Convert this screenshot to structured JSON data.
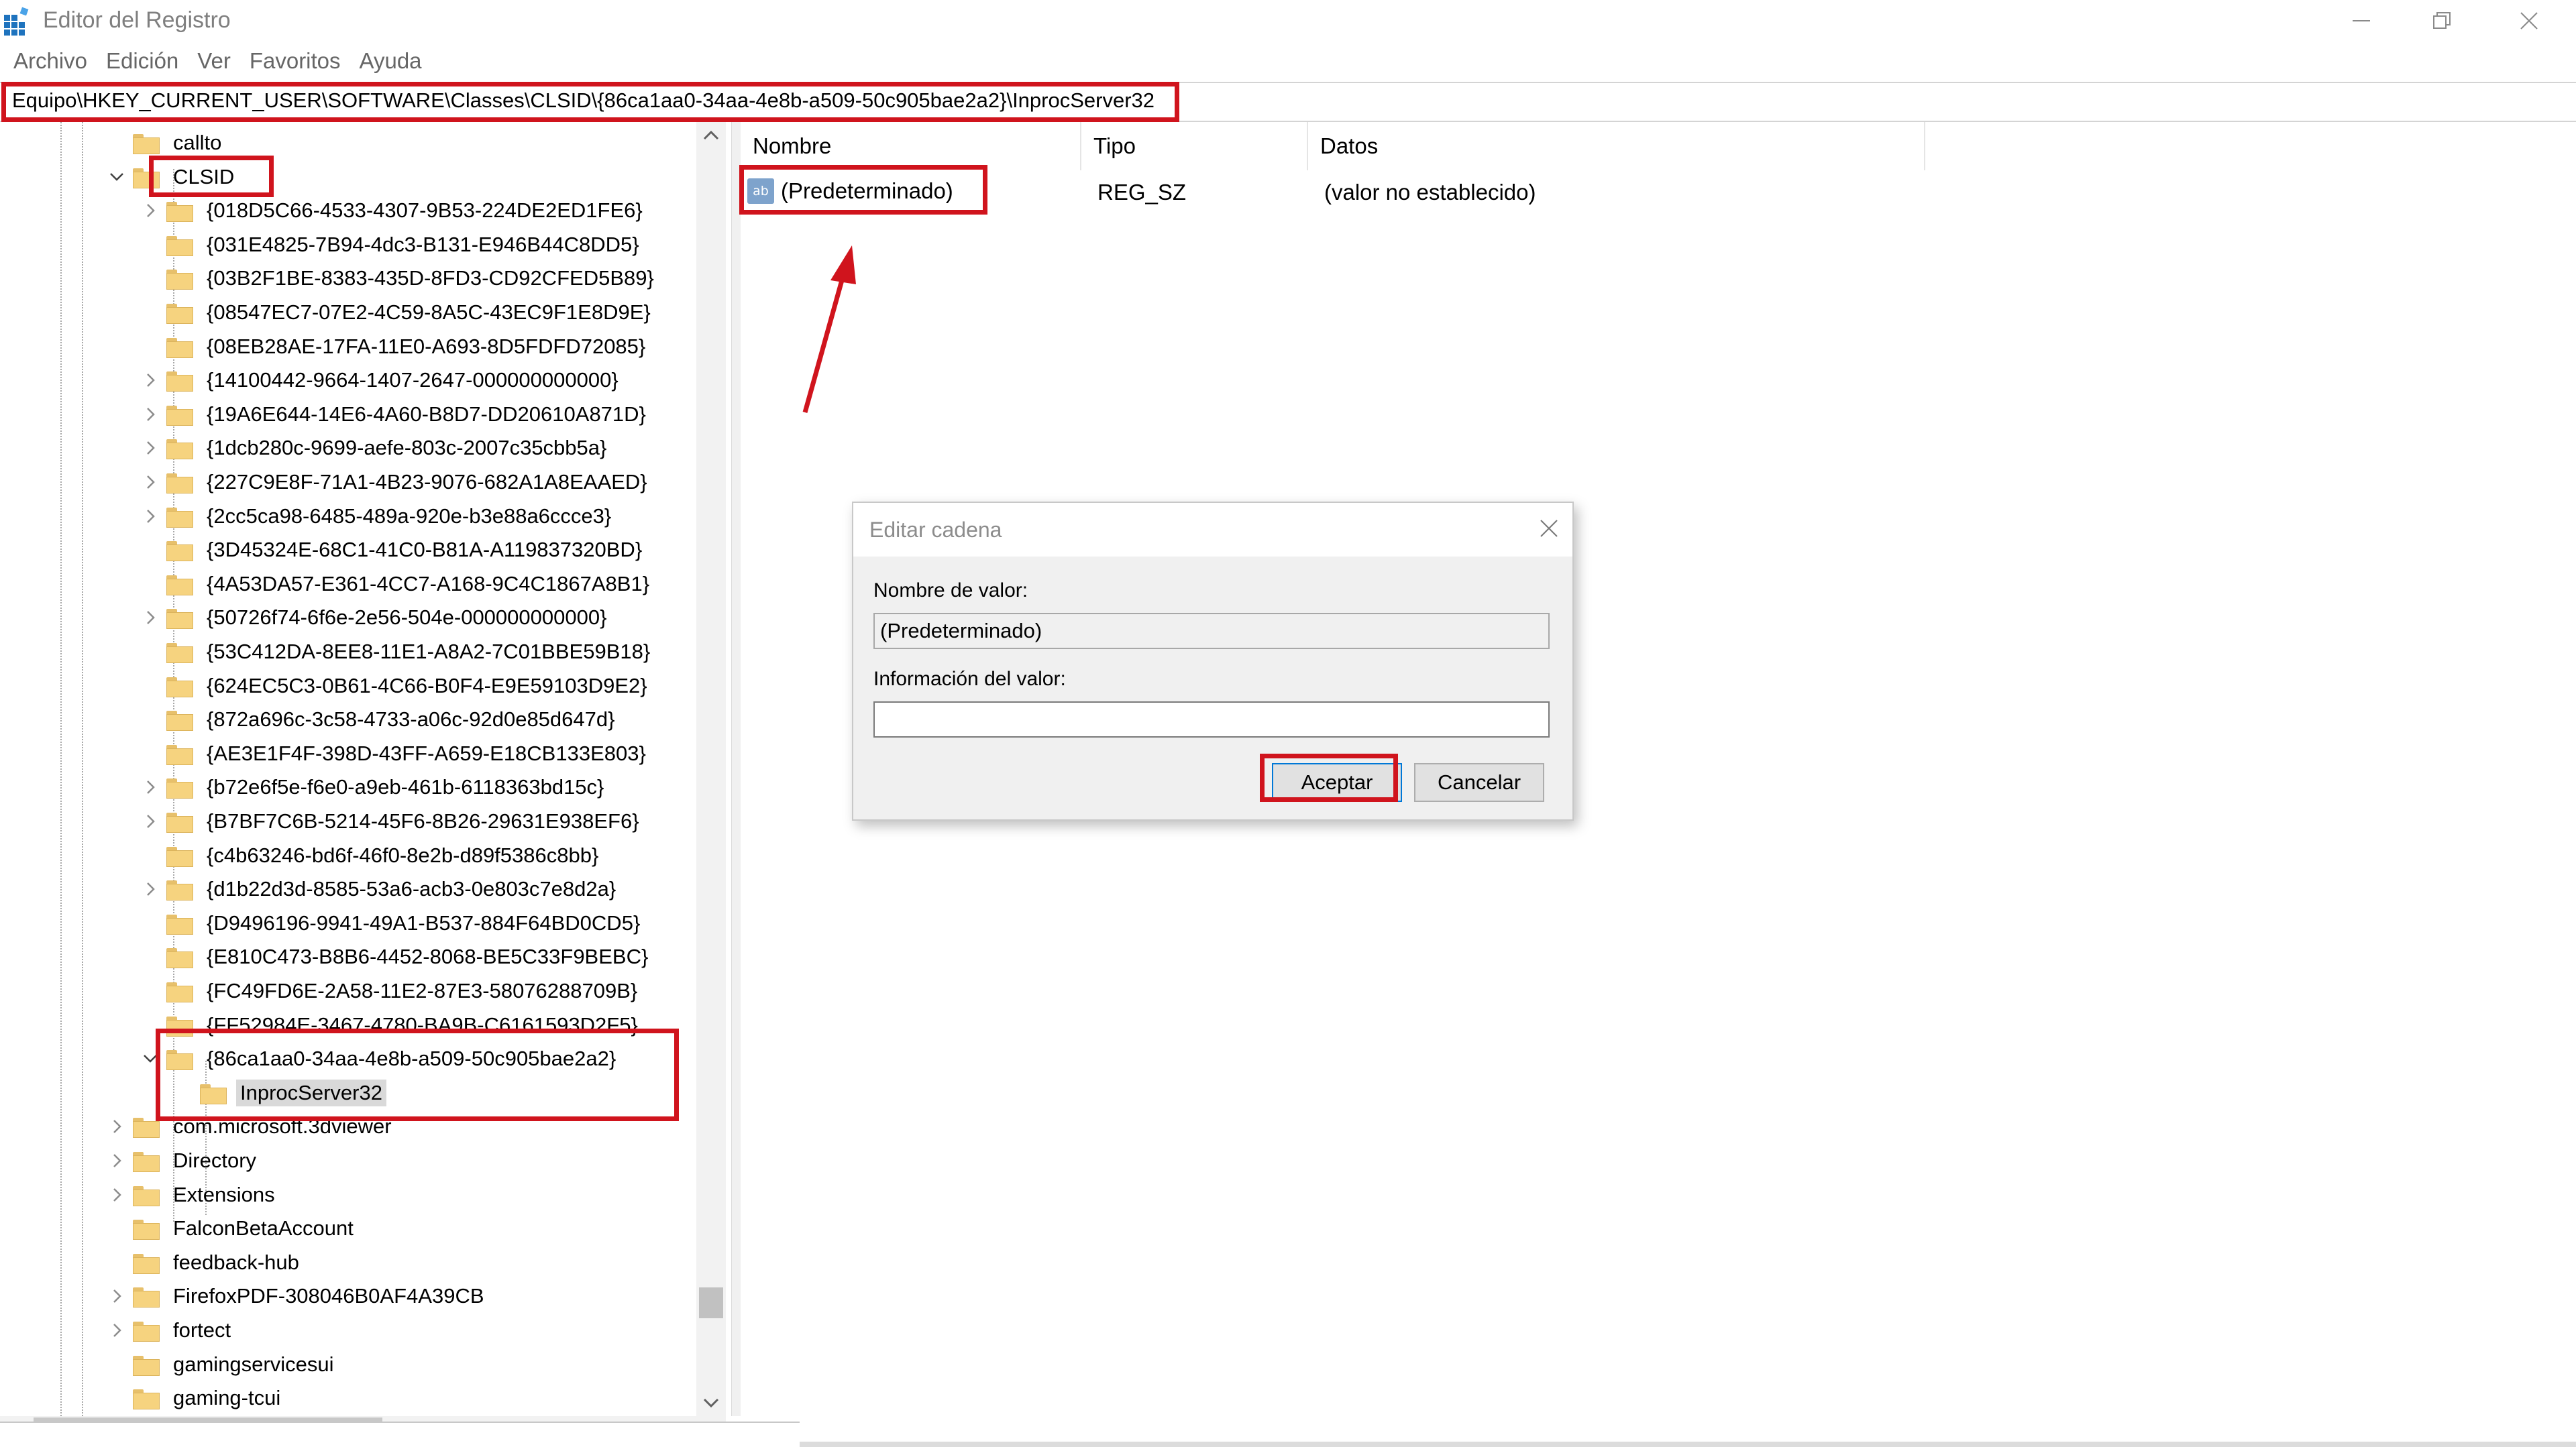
{
  "window": {
    "title": "Editor del Registro",
    "icons": [
      "registry-app-icon",
      "minimize-icon",
      "restore-icon",
      "close-icon"
    ]
  },
  "menu": [
    "Archivo",
    "Edición",
    "Ver",
    "Favoritos",
    "Ayuda"
  ],
  "address": "Equipo\\HKEY_CURRENT_USER\\SOFTWARE\\Classes\\CLSID\\{86ca1aa0-34aa-4e8b-a509-50c905bae2a2}\\InprocServer32",
  "tree": {
    "items": [
      {
        "label": "callto",
        "level": 1,
        "chevron": "none"
      },
      {
        "label": "CLSID",
        "level": 1,
        "chevron": "expanded"
      },
      {
        "label": "{018D5C66-4533-4307-9B53-224DE2ED1FE6}",
        "level": 2,
        "chevron": "collapsed"
      },
      {
        "label": "{031E4825-7B94-4dc3-B131-E946B44C8DD5}",
        "level": 2,
        "chevron": "none"
      },
      {
        "label": "{03B2F1BE-8383-435D-8FD3-CD92CFED5B89}",
        "level": 2,
        "chevron": "none"
      },
      {
        "label": "{08547EC7-07E2-4C59-8A5C-43EC9F1E8D9E}",
        "level": 2,
        "chevron": "none"
      },
      {
        "label": "{08EB28AE-17FA-11E0-A693-8D5FDFD72085}",
        "level": 2,
        "chevron": "none"
      },
      {
        "label": "{14100442-9664-1407-2647-000000000000}",
        "level": 2,
        "chevron": "collapsed"
      },
      {
        "label": "{19A6E644-14E6-4A60-B8D7-DD20610A871D}",
        "level": 2,
        "chevron": "collapsed"
      },
      {
        "label": "{1dcb280c-9699-aefe-803c-2007c35cbb5a}",
        "level": 2,
        "chevron": "collapsed"
      },
      {
        "label": "{227C9E8F-71A1-4B23-9076-682A1A8EAAED}",
        "level": 2,
        "chevron": "collapsed"
      },
      {
        "label": "{2cc5ca98-6485-489a-920e-b3e88a6ccce3}",
        "level": 2,
        "chevron": "collapsed"
      },
      {
        "label": "{3D45324E-68C1-41C0-B81A-A119837320BD}",
        "level": 2,
        "chevron": "none"
      },
      {
        "label": "{4A53DA57-E361-4CC7-A168-9C4C1867A8B1}",
        "level": 2,
        "chevron": "none"
      },
      {
        "label": "{50726f74-6f6e-2e56-504e-000000000000}",
        "level": 2,
        "chevron": "collapsed"
      },
      {
        "label": "{53C412DA-8EE8-11E1-A8A2-7C01BBE59B18}",
        "level": 2,
        "chevron": "none"
      },
      {
        "label": "{624EC5C3-0B61-4C66-B0F4-E9E59103D9E2}",
        "level": 2,
        "chevron": "none"
      },
      {
        "label": "{872a696c-3c58-4733-a06c-92d0e85d647d}",
        "level": 2,
        "chevron": "none"
      },
      {
        "label": "{AE3E1F4F-398D-43FF-A659-E18CB133E803}",
        "level": 2,
        "chevron": "none"
      },
      {
        "label": "{b72e6f5e-f6e0-a9eb-461b-6118363bd15c}",
        "level": 2,
        "chevron": "collapsed"
      },
      {
        "label": "{B7BF7C6B-5214-45F6-8B26-29631E938EF6}",
        "level": 2,
        "chevron": "collapsed"
      },
      {
        "label": "{c4b63246-bd6f-46f0-8e2b-d89f5386c8bb}",
        "level": 2,
        "chevron": "none"
      },
      {
        "label": "{d1b22d3d-8585-53a6-acb3-0e803c7e8d2a}",
        "level": 2,
        "chevron": "collapsed"
      },
      {
        "label": "{D9496196-9941-49A1-B537-884F64BD0CD5}",
        "level": 2,
        "chevron": "none"
      },
      {
        "label": "{E810C473-B8B6-4452-8068-BE5C33F9BEBC}",
        "level": 2,
        "chevron": "none"
      },
      {
        "label": "{FC49FD6E-2A58-11E2-87E3-58076288709B}",
        "level": 2,
        "chevron": "none"
      },
      {
        "label": "{FF52984E-3467-4780-BA9B-C6161593D2F5}",
        "level": 2,
        "chevron": "none"
      },
      {
        "label": "{86ca1aa0-34aa-4e8b-a509-50c905bae2a2}",
        "level": 2,
        "chevron": "expanded"
      },
      {
        "label": "InprocServer32",
        "level": 3,
        "chevron": "none",
        "selected": true
      },
      {
        "label": "com.microsoft.3dviewer",
        "level": 1,
        "chevron": "collapsed"
      },
      {
        "label": "Directory",
        "level": 1,
        "chevron": "collapsed"
      },
      {
        "label": "Extensions",
        "level": 1,
        "chevron": "collapsed"
      },
      {
        "label": "FalconBetaAccount",
        "level": 1,
        "chevron": "none"
      },
      {
        "label": "feedback-hub",
        "level": 1,
        "chevron": "none"
      },
      {
        "label": "FirefoxPDF-308046B0AF4A39CB",
        "level": 1,
        "chevron": "collapsed"
      },
      {
        "label": "fortect",
        "level": 1,
        "chevron": "collapsed"
      },
      {
        "label": "gamingservicesui",
        "level": 1,
        "chevron": "none"
      },
      {
        "label": "gaming-tcui",
        "level": 1,
        "chevron": "none"
      }
    ]
  },
  "list": {
    "columns": [
      "Nombre",
      "Tipo",
      "Datos"
    ],
    "rows": [
      {
        "name": "(Predeterminado)",
        "type": "REG_SZ",
        "data": "(valor no establecido)",
        "icon": "ab"
      }
    ]
  },
  "dialog": {
    "title": "Editar cadena",
    "value_name_label": "Nombre de valor:",
    "value_name": "(Predeterminado)",
    "value_data_label": "Información del valor:",
    "value_data": "",
    "ok": "Aceptar",
    "cancel": "Cancelar"
  },
  "annotation_color": "#d0141d"
}
